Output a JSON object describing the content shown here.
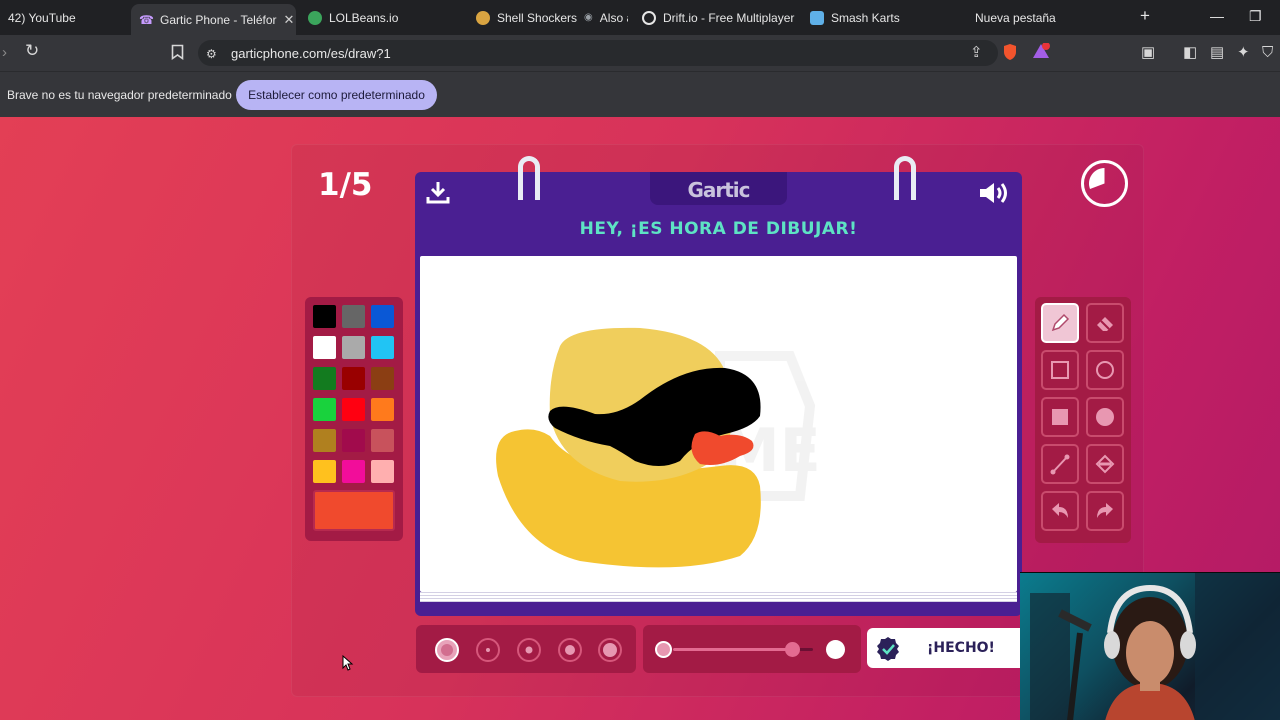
{
  "tabs": [
    {
      "label": "42) YouTube",
      "favicon_color": "#ff0000"
    },
    {
      "label": "Gartic Phone - Teléfor",
      "favicon_color": "#7b3fe4",
      "active": true
    },
    {
      "label": "LOLBeans.io",
      "favicon_color": "#3ba55c"
    },
    {
      "label": "Shell Shockers",
      "audio_label": "Also at",
      "favicon_color": "#d9a441"
    },
    {
      "label": "Drift.io - Free Multiplayer",
      "favicon_color": "#ea4335"
    },
    {
      "label": "Smash Karts",
      "favicon_color": "#5fb0e8"
    },
    {
      "label": "Nueva pestaña",
      "favicon_color": "#202124"
    }
  ],
  "address_bar": {
    "url": "garticphone.com/es/draw?1"
  },
  "infobar": {
    "message": "Brave no es tu navegador predeterminado",
    "button_label": "Establecer como predeterminado"
  },
  "game": {
    "round": "1/5",
    "logo": "Gartic",
    "prompt_title": "HEY, ¡ES HORA DE DIBUJAR!",
    "done_label": "¡HECHO!",
    "current_color": "#f04a2d",
    "opacity_level": 0.85,
    "selected_tool": "pencil",
    "selected_brush_size": 1,
    "palette": [
      [
        "#000000",
        "#666666",
        "#0a58d6"
      ],
      [
        "#ffffff",
        "#aaaaaa",
        "#21c4f4"
      ],
      [
        "#137b1f",
        "#990000",
        "#8b3e13"
      ],
      [
        "#19d23d",
        "#ff0011",
        "#ff7a1c"
      ],
      [
        "#b0801f",
        "#a10b4c",
        "#c8525c"
      ],
      [
        "#ffc11e",
        "#f20d9a",
        "#ffafaf"
      ]
    ]
  }
}
